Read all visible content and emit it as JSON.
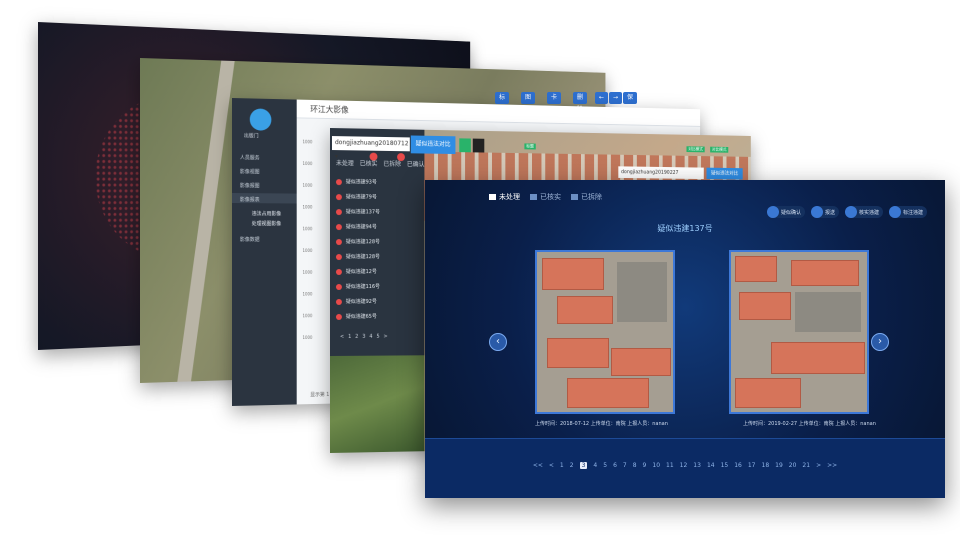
{
  "layer_admin": {
    "page_title": "环江大影像",
    "logo_text": "出版门",
    "nav": [
      "人员服务",
      "影像视图",
      "影像报图",
      "影像报表",
      "影像数据"
    ],
    "nav_sub": [
      "违法占用影像",
      "处理视图影像"
    ],
    "axis_nums": [
      "1000",
      "1000",
      "1000",
      "1000",
      "1000",
      "1000",
      "1000",
      "1000",
      "1000",
      "1000"
    ],
    "footer": "显示第 1 条"
  },
  "layer_list": {
    "select_value": "dongjiazhuang20180712",
    "select_arrow": "▾",
    "primary_button": "疑似违法对比",
    "tabs": [
      "未处理",
      "已核实",
      "已拆除",
      "已确认"
    ],
    "rows": [
      "疑似违建93号",
      "疑似违建79号",
      "疑似违建137号",
      "疑似违建94号",
      "疑似违建128号",
      "疑似违建128号",
      "疑似违建12号",
      "疑似违建116号",
      "疑似违建92号",
      "疑似违建65号"
    ],
    "pager": [
      "<",
      "1",
      "2",
      "3",
      "4",
      "5",
      ">"
    ],
    "right_select": "dongjiazhuang20190227",
    "right_button": "疑似违法对比",
    "tags": [
      "标题",
      "对比模式",
      "对比模式"
    ]
  },
  "layer_map_toolbar": [
    "标注",
    "图层",
    "卡图",
    "删除",
    "←",
    "→",
    "保存"
  ],
  "front": {
    "tabs": [
      {
        "label": "未处理",
        "active": true
      },
      {
        "label": "已核实",
        "active": false
      },
      {
        "label": "已拆除",
        "active": false
      }
    ],
    "actions": [
      "疑似确认",
      "报送",
      "核实违建",
      "标注违建"
    ],
    "title": "疑似违建137号",
    "left_caption": "上传时间：2018-07-12  上传单位：南院  上报人员：nanan",
    "right_caption": "上传时间：2019-02-27  上传单位：南院  上报人员：nanan",
    "prev_arrow": "‹",
    "next_arrow": "›",
    "pagination": [
      "<<",
      "<",
      "1",
      "2",
      "3",
      "4",
      "5",
      "6",
      "7",
      "8",
      "9",
      "10",
      "11",
      "12",
      "13",
      "14",
      "15",
      "16",
      "17",
      "18",
      "19",
      "20",
      "21",
      ">",
      ">>"
    ],
    "current_page": "3"
  }
}
